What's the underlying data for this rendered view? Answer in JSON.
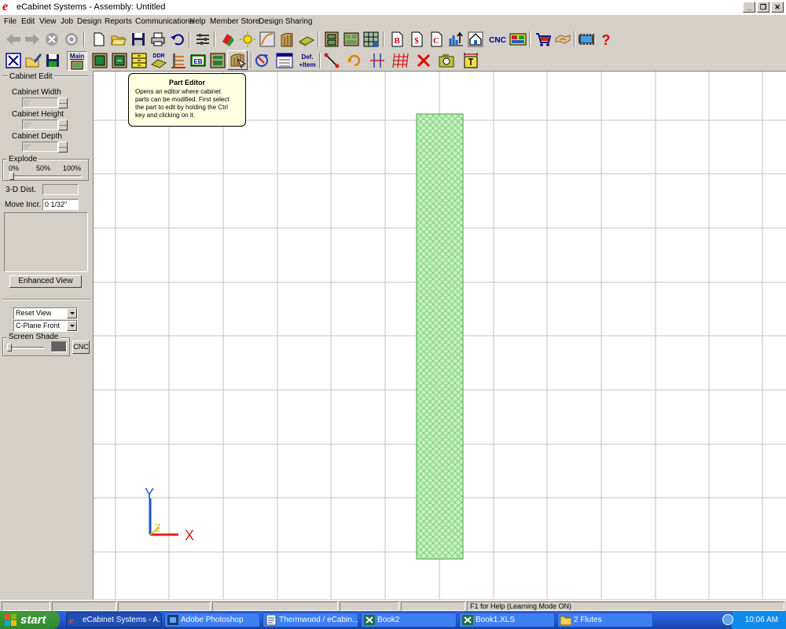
{
  "window": {
    "title": "eCabinet Systems - Assembly: Untitled",
    "logo_letter": "e",
    "controls": {
      "minimize": "_",
      "restore": "❐",
      "close": "✕"
    }
  },
  "menu": [
    "File",
    "Edit",
    "View",
    "Job",
    "Design",
    "Reports",
    "Communications",
    "Help",
    "Member Store",
    "Design Sharing"
  ],
  "toolbar1": {
    "cnc_label": "CNC",
    "b_label": "B",
    "dollar_label": "$",
    "c_label": "C",
    "help_label": "?"
  },
  "toolbar2": {
    "main_tab_label": "Main",
    "ddr_label": "DDR",
    "eb_label": "EB",
    "def_label": "Def.",
    "item_label": "+Item"
  },
  "left_panel": {
    "cabinet_edit": "Cabinet Edit",
    "width_label": "Cabinet Width",
    "width_value": "0\"",
    "height_label": "Cabinet Height",
    "height_value": "0\"",
    "depth_label": "Cabinet Depth",
    "depth_value": "0\"",
    "explode_label": "Explode",
    "explode_0": "0%",
    "explode_50": "50%",
    "explode_100": "100%",
    "explode_level": 0,
    "dist_label": "3-D Dist.",
    "dist_value": "",
    "move_label": "Move Incr.",
    "move_value": "0 1/32\"",
    "enhanced_view": "Enhanced View",
    "view_select": "Reset View",
    "plane_select": "C-Plane Front",
    "screen_shade_label": "Screen Shade",
    "cnc_button": "CNC"
  },
  "tooltip": {
    "title": "Part Editor",
    "lines": [
      "Opens an editor where cabinet",
      "parts can be modified. First select",
      "the part to edit by holding the Ctrl",
      "key and clicking on it."
    ]
  },
  "canvas": {
    "part_fill": "#c8f0c0",
    "part_hatch": "#6cd068",
    "part_stroke": "#3aa040",
    "grid_color": "#c0c0c0",
    "axis": {
      "y_label": "Y",
      "x_label": "X",
      "z_label": "Z",
      "y_color": "#2050d0",
      "x_color": "#e02020",
      "z_color": "#e0c020"
    }
  },
  "statusbar": {
    "help_text": "F1 for Help (Learning Mode ON)"
  },
  "taskbar": {
    "start": "start",
    "tasks": [
      "eCabinet Systems - A...",
      "Adobe Photoshop",
      "Thermwood / eCabin...",
      "Book2",
      "Book1.XLS",
      "2 Flutes"
    ],
    "clock": "10:06 AM"
  }
}
